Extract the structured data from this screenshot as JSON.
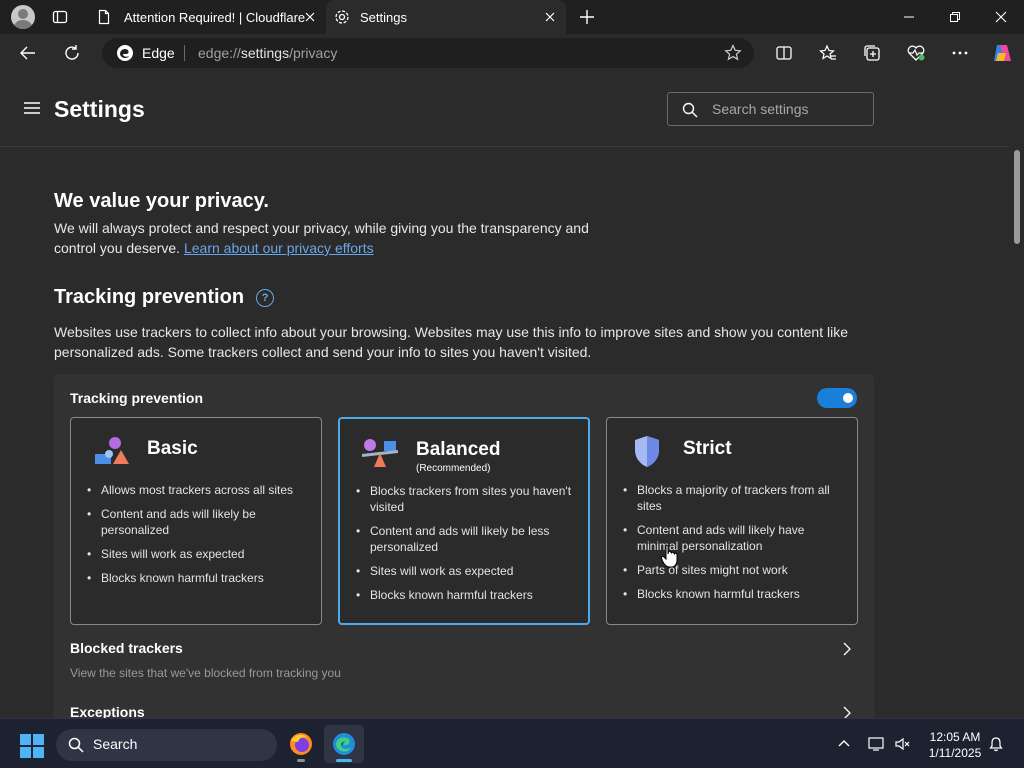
{
  "browser": {
    "tabs": [
      {
        "title": "Attention Required! | Cloudflare",
        "active": false
      },
      {
        "title": "Settings",
        "active": true
      }
    ],
    "address": {
      "brand": "Edge",
      "url_prefix": "edge://",
      "url_host": "settings",
      "url_path": "/privacy"
    }
  },
  "settings": {
    "title": "Settings",
    "search_placeholder": "Search settings"
  },
  "privacy": {
    "heading": "We value your privacy.",
    "desc": "We will always protect and respect your privacy, while giving you the transparency and control you deserve.",
    "link": "Learn about our privacy efforts"
  },
  "tracking": {
    "heading": "Tracking prevention",
    "desc": "Websites use trackers to collect info about your browsing. Websites may use this info to improve sites and show you content like personalized ads. Some trackers collect and send your info to sites you haven't visited.",
    "card_label": "Tracking prevention",
    "enabled": true,
    "levels": [
      {
        "title": "Basic",
        "subtitle": "",
        "selected": false,
        "items": [
          "Allows most trackers across all sites",
          "Content and ads will likely be personalized",
          "Sites will work as expected",
          "Blocks known harmful trackers"
        ]
      },
      {
        "title": "Balanced",
        "subtitle": "(Recommended)",
        "selected": true,
        "items": [
          "Blocks trackers from sites you haven't visited",
          "Content and ads will likely be less personalized",
          "Sites will work as expected",
          "Blocks known harmful trackers"
        ]
      },
      {
        "title": "Strict",
        "subtitle": "",
        "selected": false,
        "items": [
          "Blocks a majority of trackers from all sites",
          "Content and ads will likely have minimal personalization",
          "Parts of sites might not work",
          "Blocks known harmful trackers"
        ]
      }
    ],
    "blocked_title": "Blocked trackers",
    "blocked_desc": "View the sites that we've blocked from tracking you",
    "exceptions_title": "Exceptions"
  },
  "taskbar": {
    "search_label": "Search",
    "time": "12:05 AM",
    "date": "1/11/2025"
  },
  "colors": {
    "accent": "#4ea8e9",
    "link": "#69a7ea",
    "toggle": "#1a7fd9"
  }
}
